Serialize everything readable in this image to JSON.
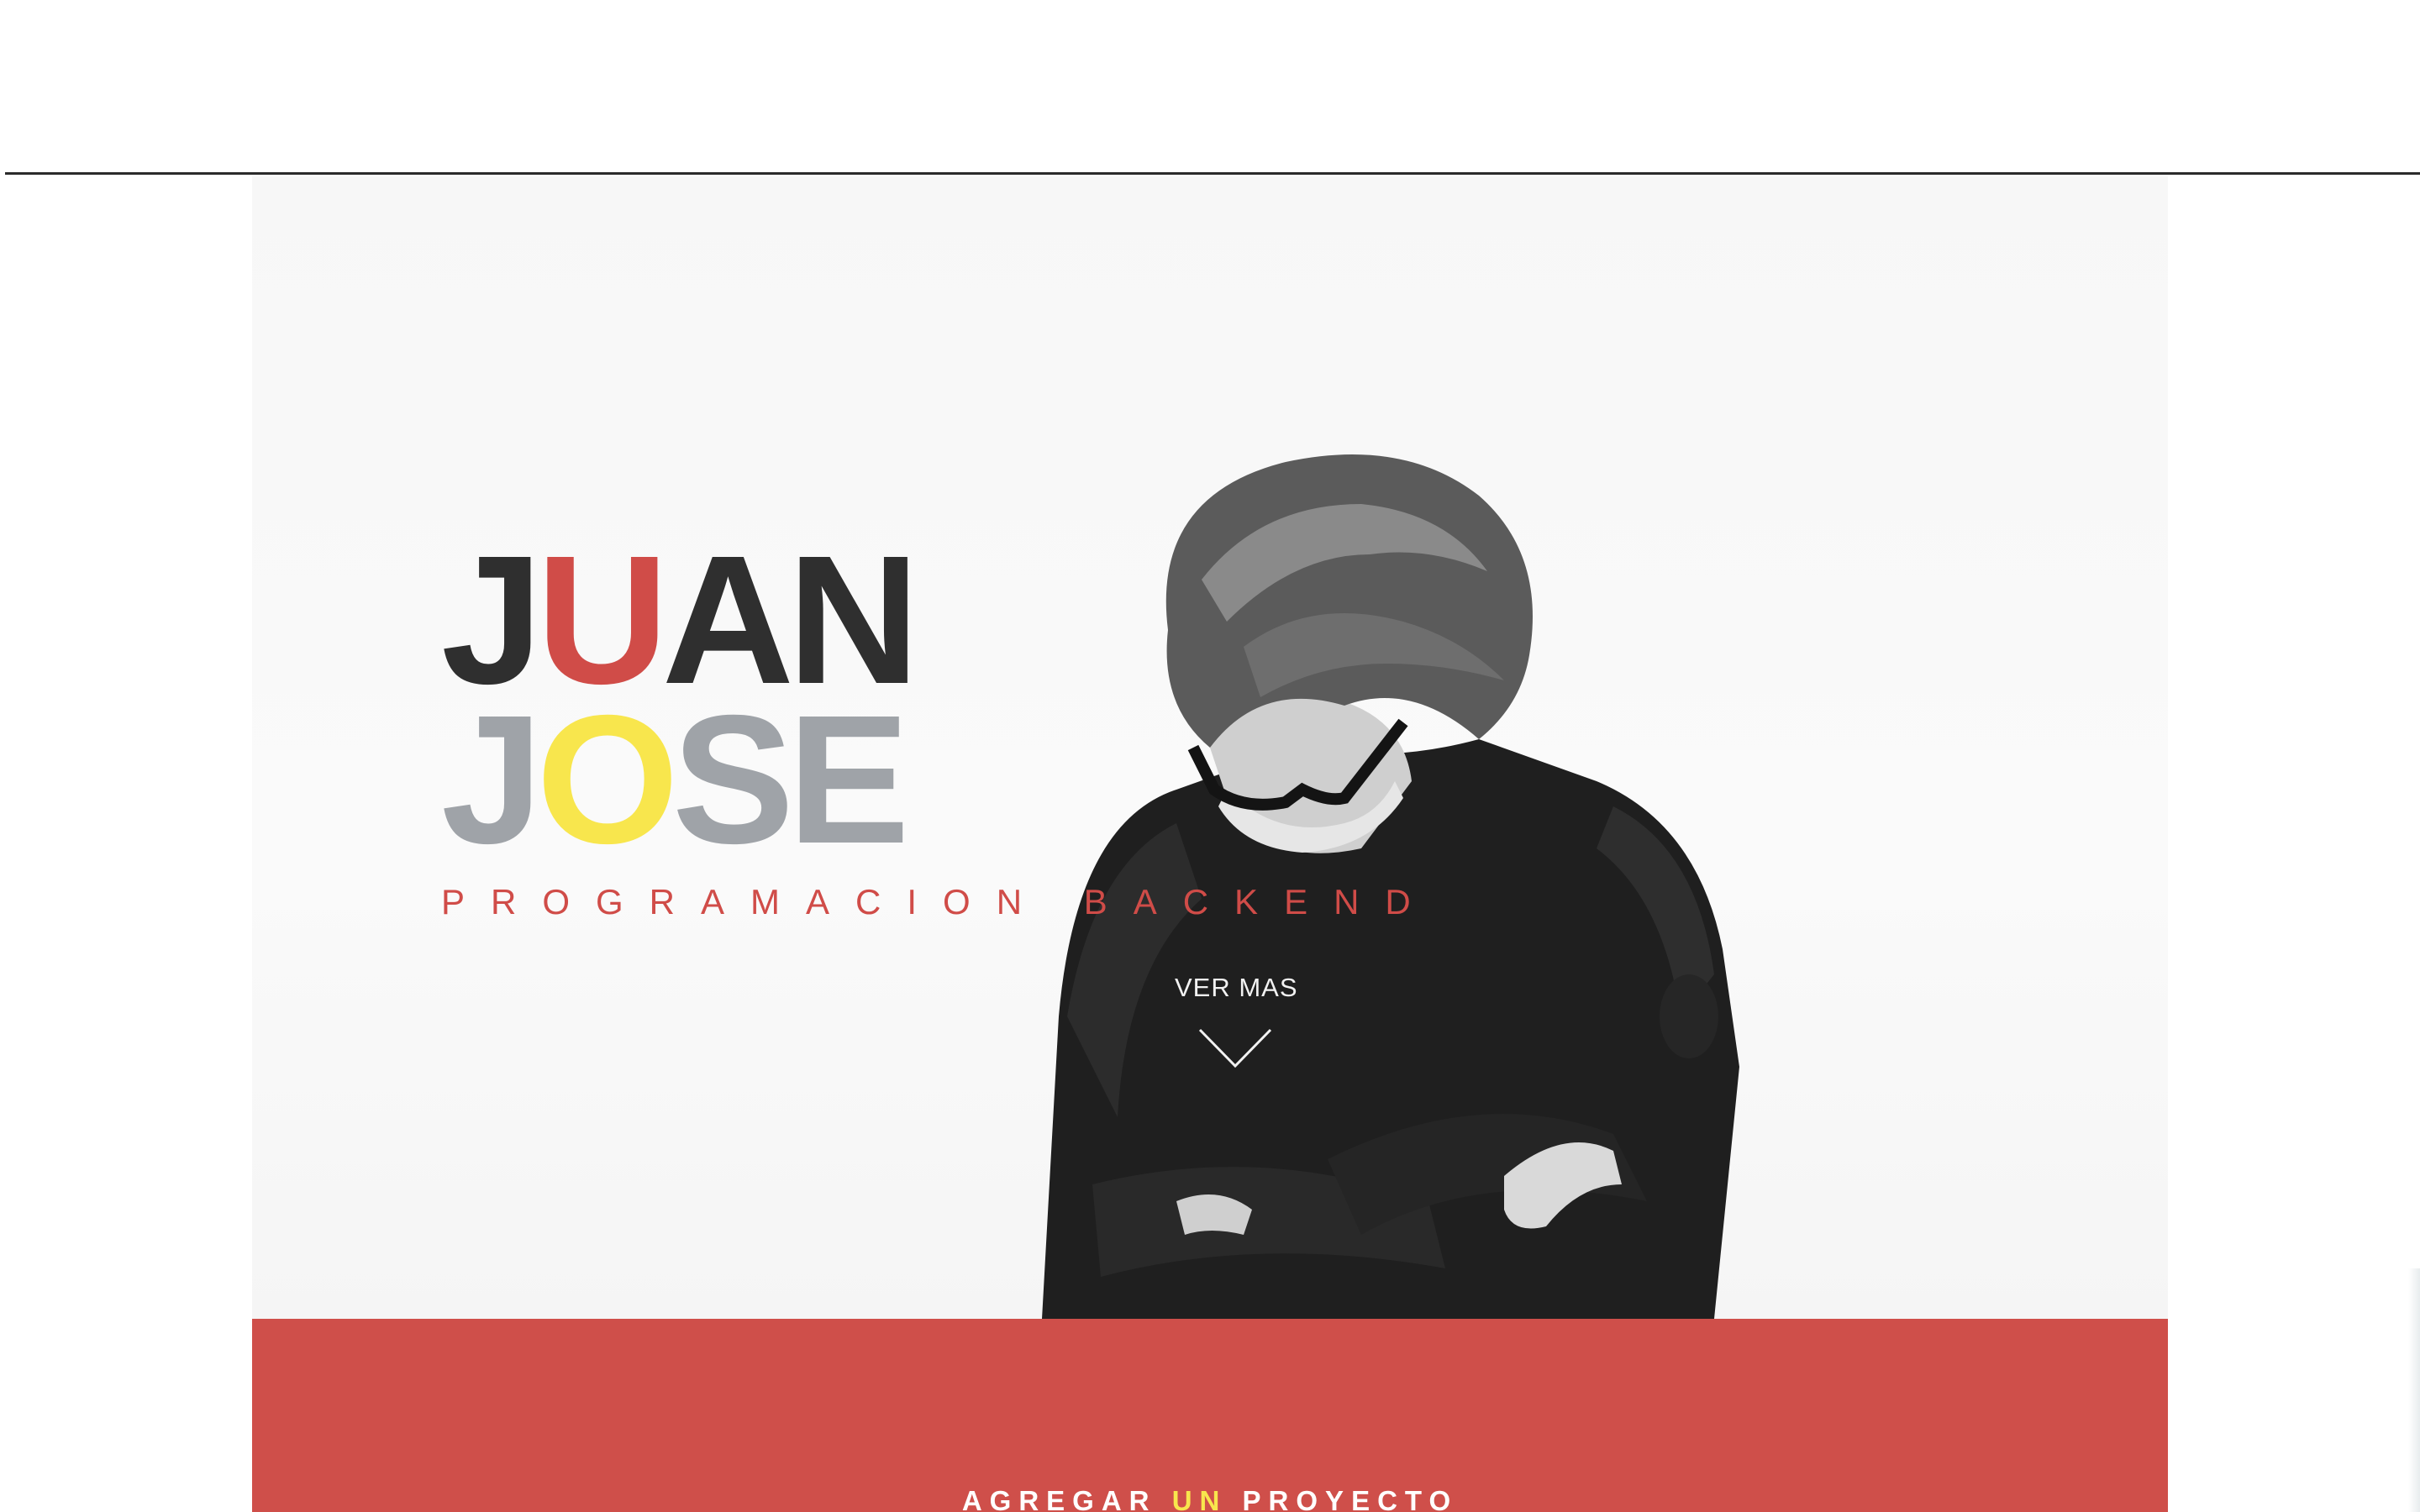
{
  "hero": {
    "name_first": {
      "part1": "J",
      "accent": "U",
      "part2": "AN"
    },
    "name_last": {
      "part1": "J",
      "accent": "O",
      "part2": "SE"
    },
    "subtitle": "PROGRAMACION BACKEND",
    "ver_mas": {
      "label": "VER MAS",
      "icon": "chevron-down-icon"
    },
    "photo": {
      "subject": "portrait-photo"
    }
  },
  "cta": {
    "part1": "AGREGAR",
    "accent": "UN",
    "part2": "PROYECTO"
  },
  "colors": {
    "accent_red": "#d04c48",
    "accent_yellow": "#f8e64d",
    "dark_text": "#2f2f2f",
    "grey_text": "#9fa3a8",
    "band_red": "#cf4f4a"
  }
}
